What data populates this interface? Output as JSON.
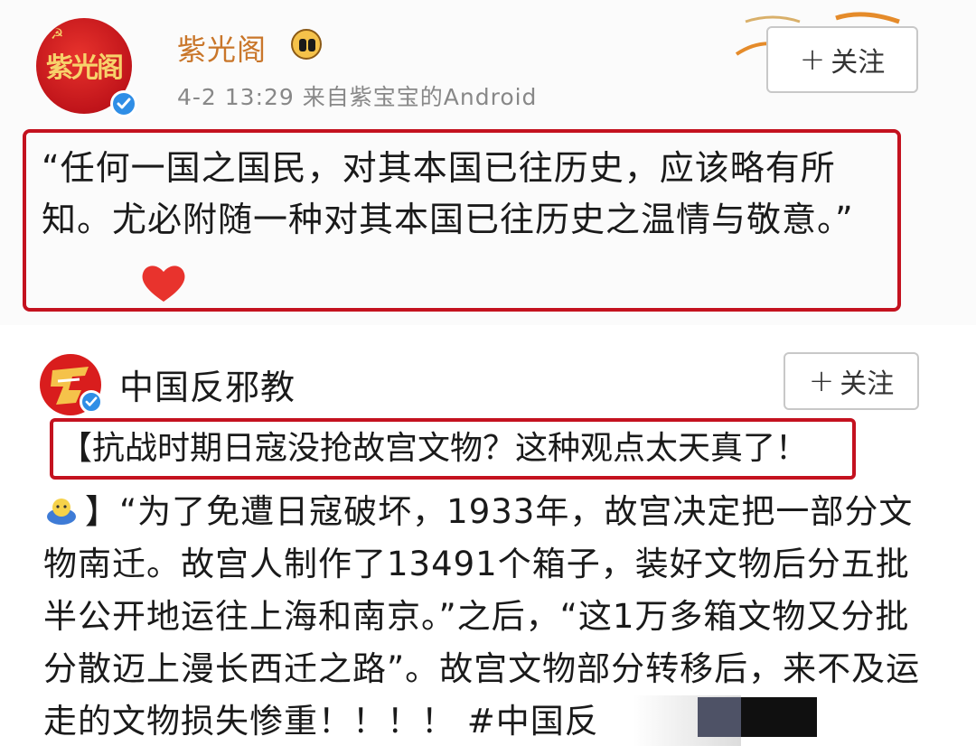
{
  "post1": {
    "avatar_text": "紫光阁",
    "author": "紫光阁",
    "meta": "4-2 13:29  来自紫宝宝的Android",
    "follow_label": "关注",
    "quote": "“任何一国之国民，对其本国已往历史，应该略有所知。尤必附随一种对其本国已往历史之温情与敬意。”"
  },
  "post2": {
    "author": "中国反邪教",
    "follow_label": "关注",
    "headline": "【抗战时期日寇没抢故宫文物？这种观点太天真了！",
    "body": "】“为了免遭日寇破坏，1933年，故宫决定把一部分文物南迁。故宫人制作了13491个箱子，装好文物后分五批半公开地运往上海和南京。”之后，“这1万多箱文物又分批分散迈上漫长西迁之路”。故宫文物部分转移后，来不及运走的文物损失惨重！！！！ #中国反"
  },
  "colors": {
    "highlight_border": "#c4121f",
    "verified_badge": "#2f8ee6",
    "author1_name": "#c9762a",
    "meta_text": "#888888"
  },
  "icons": [
    "verified-badge-icon",
    "vip-crown-icon",
    "red-heart-icon",
    "plus-icon",
    "emoji-icon"
  ]
}
